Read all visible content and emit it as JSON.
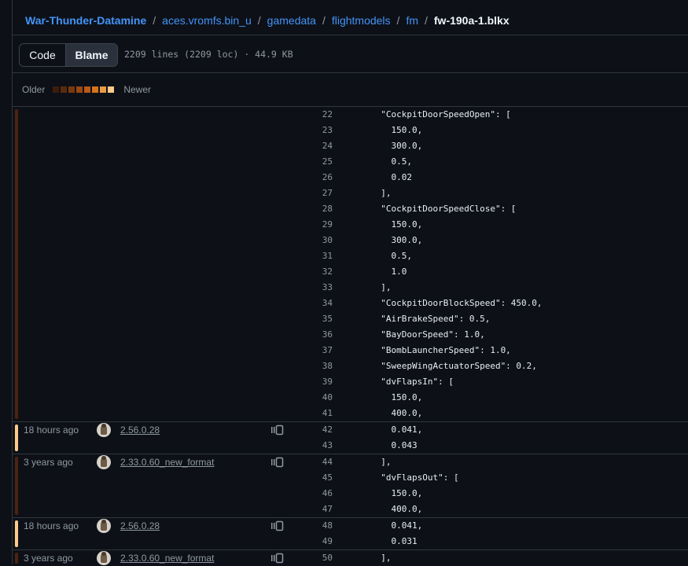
{
  "breadcrumb": {
    "items": [
      "War-Thunder-Datamine",
      "aces.vromfs.bin_u",
      "gamedata",
      "flightmodels",
      "fm"
    ],
    "separator": "/",
    "current": "fw-190a-1.blkx"
  },
  "toolbar": {
    "code_label": "Code",
    "blame_label": "Blame",
    "file_info": "2209 lines (2209 loc) · 44.9 KB"
  },
  "legend": {
    "older_label": "Older",
    "newer_label": "Newer",
    "colors": [
      "#3d1d0a",
      "#5b2a0c",
      "#7a380f",
      "#9a4712",
      "#bb5916",
      "#d8741c",
      "#ec9a45",
      "#ffc98a"
    ]
  },
  "hunks": [
    {
      "age": "",
      "message": "",
      "bar_color": "#4d2410",
      "lines": [
        {
          "n": "22",
          "code": "  \"CockpitDoorSpeedOpen\": ["
        },
        {
          "n": "23",
          "code": "    150.0,"
        },
        {
          "n": "24",
          "code": "    300.0,"
        },
        {
          "n": "25",
          "code": "    0.5,"
        },
        {
          "n": "26",
          "code": "    0.02"
        },
        {
          "n": "27",
          "code": "  ],"
        },
        {
          "n": "28",
          "code": "  \"CockpitDoorSpeedClose\": ["
        },
        {
          "n": "29",
          "code": "    150.0,"
        },
        {
          "n": "30",
          "code": "    300.0,"
        },
        {
          "n": "31",
          "code": "    0.5,"
        },
        {
          "n": "32",
          "code": "    1.0"
        },
        {
          "n": "33",
          "code": "  ],"
        },
        {
          "n": "34",
          "code": "  \"CockpitDoorBlockSpeed\": 450.0,"
        },
        {
          "n": "35",
          "code": "  \"AirBrakeSpeed\": 0.5,"
        },
        {
          "n": "36",
          "code": "  \"BayDoorSpeed\": 1.0,"
        },
        {
          "n": "37",
          "code": "  \"BombLauncherSpeed\": 1.0,"
        },
        {
          "n": "38",
          "code": "  \"SweepWingActuatorSpeed\": 0.2,"
        },
        {
          "n": "39",
          "code": "  \"dvFlapsIn\": ["
        },
        {
          "n": "40",
          "code": "    150.0,"
        },
        {
          "n": "41",
          "code": "    400.0,"
        }
      ]
    },
    {
      "age": "18 hours ago",
      "message": "2.56.0.28",
      "bar_color": "#ffc98a",
      "lines": [
        {
          "n": "42",
          "code": "    0.041,"
        },
        {
          "n": "43",
          "code": "    0.043"
        }
      ]
    },
    {
      "age": "3 years ago",
      "message": "2.33.0.60_new_format",
      "bar_color": "#4d2410",
      "lines": [
        {
          "n": "44",
          "code": "  ],"
        },
        {
          "n": "45",
          "code": "  \"dvFlapsOut\": ["
        },
        {
          "n": "46",
          "code": "    150.0,"
        },
        {
          "n": "47",
          "code": "    400.0,"
        }
      ]
    },
    {
      "age": "18 hours ago",
      "message": "2.56.0.28",
      "bar_color": "#ffc98a",
      "lines": [
        {
          "n": "48",
          "code": "    0.041,"
        },
        {
          "n": "49",
          "code": "    0.031"
        }
      ]
    },
    {
      "age": "3 years ago",
      "message": "2.33.0.60_new_format",
      "bar_color": "#4d2410",
      "lines": [
        {
          "n": "50",
          "code": "  ],"
        }
      ]
    }
  ]
}
